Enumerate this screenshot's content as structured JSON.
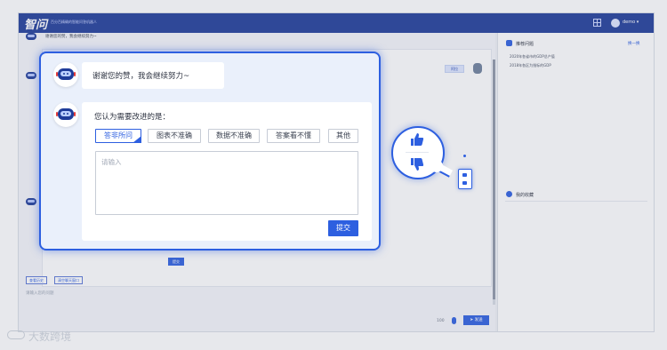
{
  "app": {
    "logo": "智问",
    "subtitle": "百分百精确的智能问答机器人",
    "user_name": "demo ▾"
  },
  "chat": {
    "top_message": "谢谢您的赞，我会继续努力~",
    "user_bubble": "阿拉",
    "submit_small": "提交",
    "tools": [
      "查看历史",
      "清空聊天窗口"
    ],
    "input_placeholder": "请输入您的问题",
    "counter": "100",
    "send_label": "发送"
  },
  "right_panel": {
    "hot_title": "推荐问题",
    "refresh": "换一换",
    "items": [
      "2020年各省市的GDP总产值",
      "2018年各区为指标的GDP"
    ],
    "fav_title": "我的收藏"
  },
  "dialog": {
    "thanks": "谢谢您的赞，我会继续努力~",
    "question": "您认为需要改进的是：",
    "options": [
      "答非所问",
      "图表不准确",
      "数据不准确",
      "答案看不懂",
      "其他"
    ],
    "selected_option": "答非所问",
    "textarea_placeholder": "请输入",
    "submit": "提交"
  },
  "watermark": "大数跨境",
  "colors": {
    "primary": "#2d5fe0",
    "topbar": "#1f3c99"
  },
  "icons": [
    "thumbs-up-icon",
    "thumbs-down-icon",
    "robot-icon",
    "grid-icon",
    "mic-icon",
    "send-icon"
  ]
}
